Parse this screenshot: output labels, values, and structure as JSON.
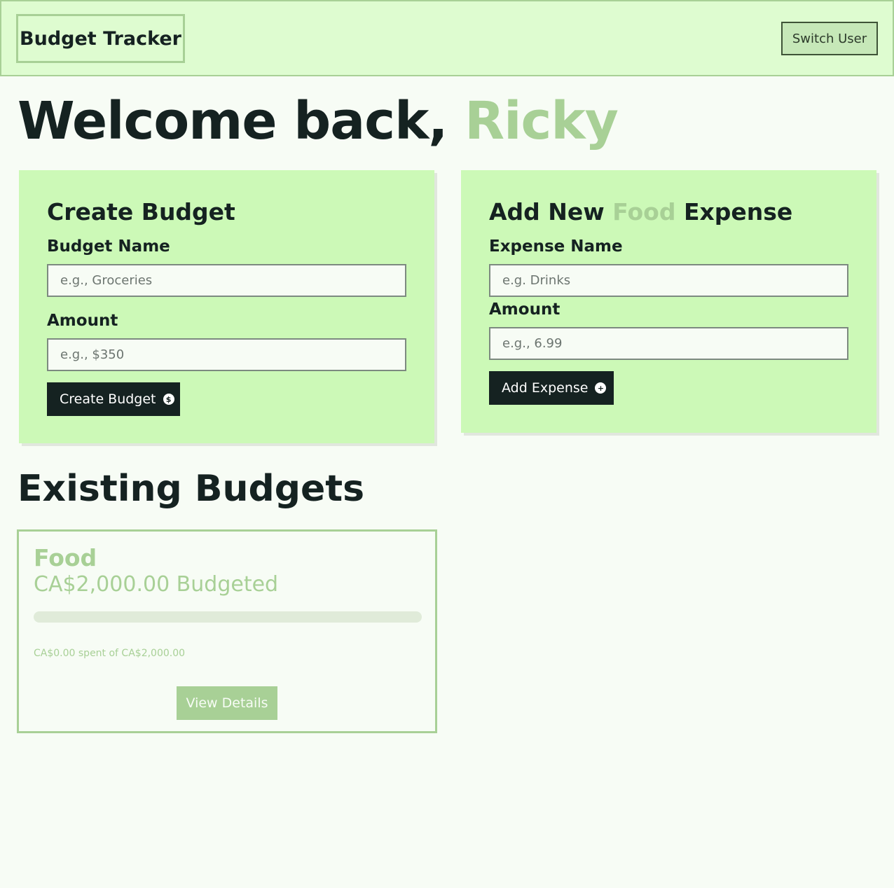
{
  "header": {
    "logo_text": "Budget Tracker",
    "switch_user_label": "Switch User"
  },
  "welcome": {
    "prefix": "Welcome back,",
    "user_name": "Ricky"
  },
  "create_budget": {
    "title": "Create Budget",
    "name_label": "Budget Name",
    "name_placeholder": "e.g., Groceries",
    "amount_label": "Amount",
    "amount_placeholder": "e.g., $350",
    "submit_label": "Create Budget",
    "submit_icon": "dollar-circle-icon"
  },
  "add_expense": {
    "title_prefix": "Add New",
    "title_category": "Food",
    "title_suffix": "Expense",
    "name_label": "Expense Name",
    "name_placeholder": "e.g. Drinks",
    "amount_label": "Amount",
    "amount_placeholder": "e.g., 6.99",
    "submit_label": "Add Expense",
    "submit_icon": "plus-circle-icon"
  },
  "existing_budgets": {
    "title": "Existing Budgets",
    "items": [
      {
        "name": "Food",
        "budgeted_text": "CA$2,000.00 Budgeted",
        "spent_text": "CA$0.00 spent of CA$2,000.00",
        "progress_fraction": 0,
        "view_label": "View Details"
      }
    ]
  },
  "colors": {
    "accent": "#a8d096",
    "dark": "#152221",
    "card_bg": "#ccf9b7",
    "header_bg": "#defcd0",
    "page_bg": "#f7fcf5"
  }
}
